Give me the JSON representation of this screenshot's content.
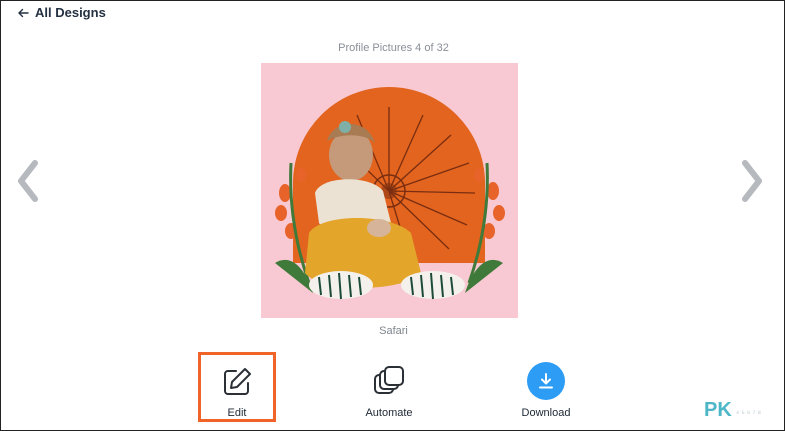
{
  "header": {
    "back_label": "All Designs"
  },
  "carousel": {
    "counter": "Profile Pictures 4 of 32",
    "design_name": "Safari"
  },
  "actions": [
    {
      "label": "Edit",
      "icon": "edit-pencil-icon"
    },
    {
      "label": "Automate",
      "icon": "stacked-cards-icon"
    },
    {
      "label": "Download",
      "icon": "download-icon"
    }
  ],
  "watermark": {
    "text": "PK",
    "tail": "⁴ ⁵ ⁶ ⁷ ⁸"
  },
  "colors": {
    "accent_highlight": "#f0642a",
    "download_blue": "#2d9cf4",
    "preview_bg": "#f8c9d2",
    "sun_orange": "#e2641e",
    "watermark_teal": "#4db7c7"
  }
}
